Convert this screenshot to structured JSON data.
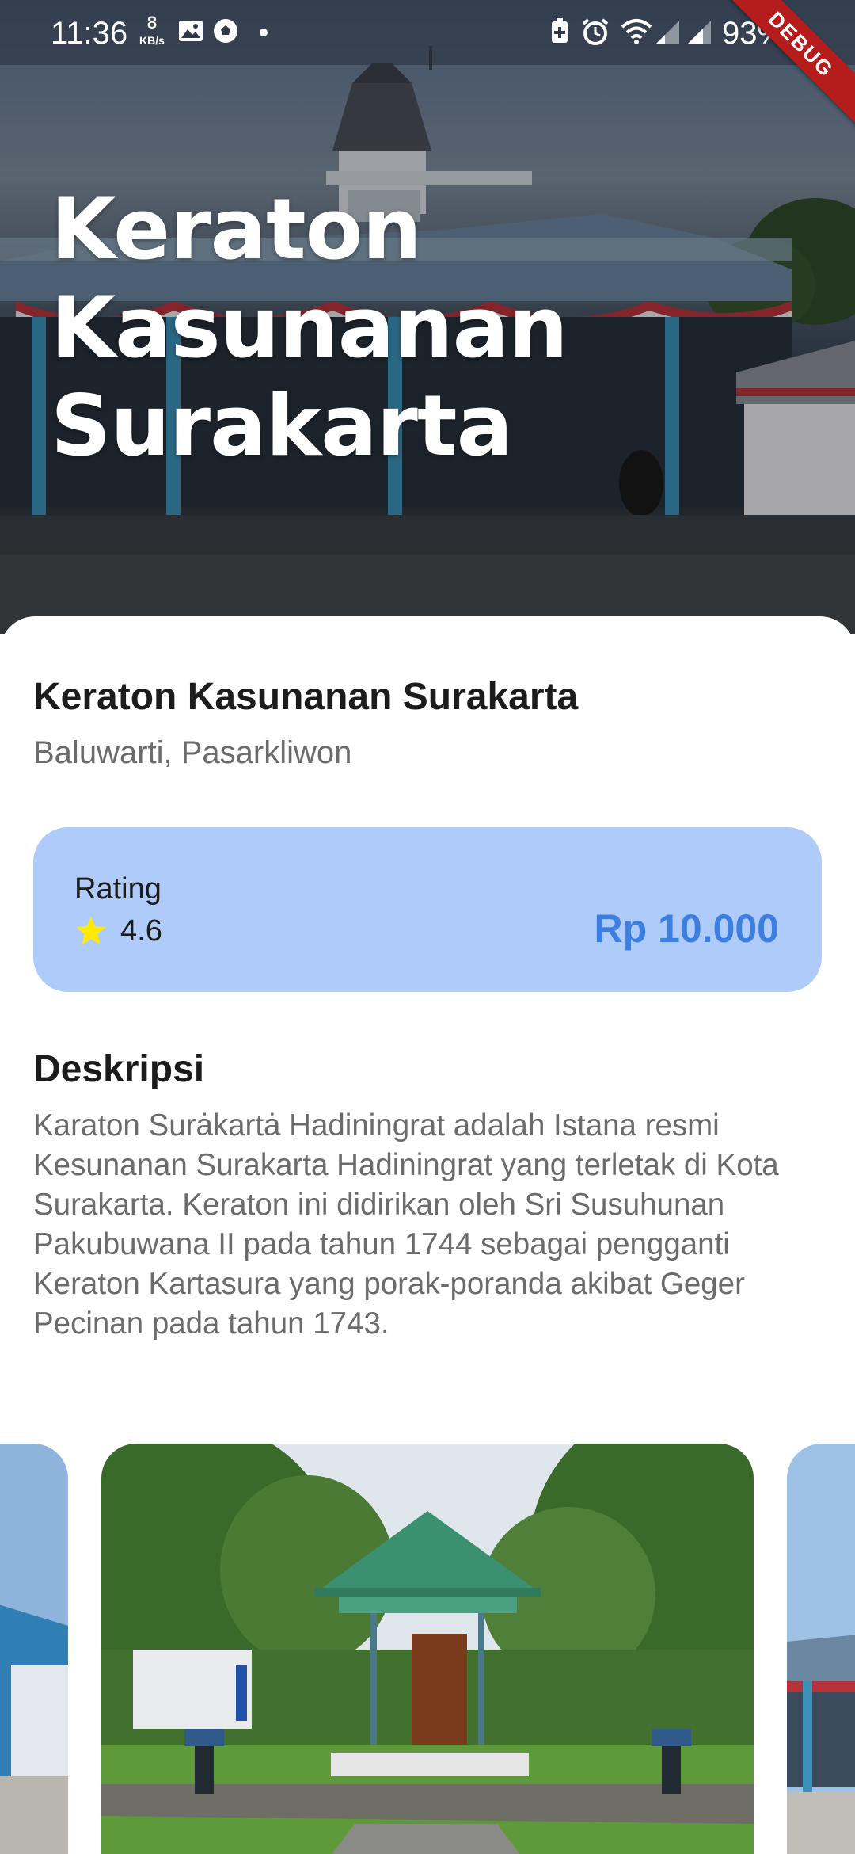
{
  "status_bar": {
    "time": "11:36",
    "net_speed": "8",
    "net_speed_unit": "KB/s",
    "battery": "93%",
    "debug_label": "DEBUG",
    "icons": [
      "image-icon",
      "soccer-ball-icon",
      "dot-icon",
      "battery-saver-icon",
      "alarm-icon",
      "wifi-icon",
      "signal-icon",
      "signal-icon"
    ]
  },
  "hero": {
    "title": "Keraton Kasunanan Surakarta"
  },
  "detail": {
    "name": "Keraton Kasunanan Surakarta",
    "location": "Baluwarti, Pasarkliwon",
    "rating_label": "Rating",
    "rating_value": "4.6",
    "price": "Rp 10.000",
    "description_title": "Deskripsi",
    "description": "Karaton Surȧkartȧ Hadiningrat adalah Istana resmi Kesunanan Surakarta Hadiningrat yang terletak di Kota Surakarta. Keraton ini didirikan oleh Sri Susuhunan Pakubuwana II pada tahun 1744 sebagai pengganti Keraton Kartasura yang porak-poranda akibat Geger Pecinan pada tahun 1743."
  },
  "colors": {
    "rating_card_bg": "#aecbfa",
    "price": "#3d7fe0",
    "star": "#ffeb00",
    "debug_banner": "#b71c1c",
    "secondary_text": "#6b6b6b"
  }
}
